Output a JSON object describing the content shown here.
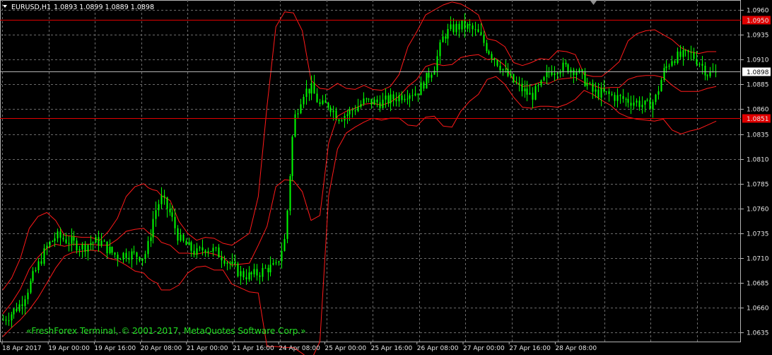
{
  "header": {
    "symbol_label": "EURUSD,H1",
    "ohlc_label": "1.0893 1.0899 1.0889 1.0898"
  },
  "watermark": "«FreshForex Terminal, © 2001-2017, MetaQuotes Software Corp.»",
  "colors": {
    "background": "#000000",
    "grid": "#6b6b6b",
    "candle": "#00ff00",
    "bands": "#ff1a1a",
    "level_line": "#e00000",
    "current_line": "#b4b4b4",
    "axis_text": "#e6e6e6",
    "watermark": "#22e022"
  },
  "chart_data": {
    "type": "line",
    "title": "",
    "symbol": "EURUSD",
    "timeframe": "H1",
    "ylim": [
      1.0626,
      1.097
    ],
    "grid": true,
    "y_ticks": [
      "1.0960",
      "1.0935",
      "1.0910",
      "1.0885",
      "1.0860",
      "1.0835",
      "1.0810",
      "1.0785",
      "1.0760",
      "1.0735",
      "1.0710",
      "1.0685",
      "1.0660",
      "1.0635"
    ],
    "x_ticks": [
      "18 Apr 2017",
      "19 Apr 00:00",
      "19 Apr 16:00",
      "20 Apr 08:00",
      "21 Apr 00:00",
      "21 Apr 16:00",
      "24 Apr 08:00",
      "25 Apr 00:00",
      "25 Apr 16:00",
      "26 Apr 08:00",
      "27 Apr 00:00",
      "27 Apr 16:00",
      "28 Apr 08:00"
    ],
    "levels": [
      {
        "name": "upper-level",
        "value": 1.095,
        "label": "1.0950"
      },
      {
        "name": "lower-level",
        "value": 1.0851,
        "label": "1.0851"
      }
    ],
    "current_price": {
      "value": 1.0898,
      "label": "1.0898"
    },
    "series": [
      {
        "type": "line",
        "x": [
          0,
          10,
          20,
          30,
          40,
          50,
          60,
          70,
          80,
          90,
          100,
          110,
          120,
          130,
          140,
          150,
          160,
          165,
          170,
          175,
          180,
          190,
          200,
          210,
          220,
          230,
          240,
          250,
          260,
          270,
          280,
          290,
          300,
          310,
          320,
          330,
          340,
          350,
          360,
          370,
          380,
          390,
          400,
          410,
          420,
          430,
          440,
          450,
          460,
          470,
          480,
          490,
          500,
          510,
          520,
          530,
          540,
          550,
          560,
          570,
          580,
          590,
          600,
          610,
          620,
          630,
          640,
          650,
          660,
          670,
          680,
          690,
          700,
          710,
          720,
          730,
          740,
          750,
          760,
          770,
          780,
          790,
          800,
          810
        ],
        "y": [
          1.0648,
          1.0655,
          1.0664,
          1.0683,
          1.0703,
          1.0722,
          1.0732,
          1.0729,
          1.0725,
          1.0721,
          1.0726,
          1.0727,
          1.0718,
          1.0712,
          1.0715,
          1.0713,
          1.0712,
          1.0724,
          1.0748,
          1.0763,
          1.077,
          1.0754,
          1.0729,
          1.0721,
          1.0715,
          1.0721,
          1.0717,
          1.0711,
          1.0702,
          1.0694,
          1.0692,
          1.0695,
          1.07,
          1.0701,
          1.073,
          1.0848,
          1.0877,
          1.0881,
          1.0863,
          1.0865,
          1.0852,
          1.0855,
          1.0861,
          1.0868,
          1.0867,
          1.0867,
          1.087,
          1.0873,
          1.0877,
          1.0877,
          1.089,
          1.0904,
          1.0934,
          1.0941,
          1.0944,
          1.0942,
          1.0935,
          1.0921,
          1.0909,
          1.0897,
          1.0887,
          1.0879,
          1.0873,
          1.0883,
          1.0898,
          1.0902,
          1.0902,
          1.09,
          1.0889,
          1.0877,
          1.0876,
          1.0874,
          1.0871,
          1.0869,
          1.0867,
          1.0863,
          1.0869,
          1.0898,
          1.0912,
          1.0913,
          1.0916,
          1.0908,
          1.0896,
          1.0896
        ]
      },
      {
        "type": "line",
        "x": [
          0,
          10,
          20,
          30,
          40,
          50,
          60,
          70,
          80,
          90,
          100,
          110,
          120,
          130,
          140,
          150,
          160,
          165,
          170,
          175,
          180,
          190,
          200,
          210,
          220,
          230,
          240,
          250,
          260,
          270,
          280,
          290,
          300,
          310,
          320,
          330,
          340,
          350,
          360,
          370,
          380,
          390,
          400,
          410,
          420,
          430,
          440,
          450,
          460,
          470,
          480,
          490,
          500,
          510,
          520,
          530,
          540,
          550,
          560,
          570,
          580,
          590,
          600,
          610,
          620,
          630,
          640,
          650,
          660,
          670,
          680,
          690,
          700,
          710,
          720,
          730,
          740,
          750,
          760,
          770,
          780,
          790,
          800,
          810
        ],
        "y": [
          1.0678,
          1.069,
          1.071,
          1.074,
          1.0752,
          1.0756,
          1.0748,
          1.0733,
          1.0732,
          1.0731,
          1.0731,
          1.0728,
          1.0737,
          1.075,
          1.0772,
          1.0782,
          1.0785,
          1.0781,
          1.0779,
          1.0778,
          1.0773,
          1.0768,
          1.0747,
          1.0735,
          1.0728,
          1.0731,
          1.073,
          1.0725,
          1.0723,
          1.0729,
          1.0735,
          1.0772,
          1.0863,
          1.0943,
          1.0958,
          1.0957,
          1.0939,
          1.0889,
          1.0881,
          1.088,
          1.0886,
          1.0881,
          1.088,
          1.0884,
          1.088,
          1.0879,
          1.0883,
          1.0895,
          1.0923,
          1.0938,
          1.0955,
          1.096,
          1.0965,
          1.0968,
          1.0966,
          1.0961,
          1.0955,
          1.0931,
          1.0929,
          1.0923,
          1.0907,
          1.0904,
          1.0907,
          1.0911,
          1.091,
          1.0919,
          1.0918,
          1.0915,
          1.0895,
          1.0893,
          1.0893,
          1.09,
          1.0908,
          1.0929,
          1.0936,
          1.0939,
          1.094,
          1.0935,
          1.093,
          1.0922,
          1.0918,
          1.0916,
          1.0918,
          1.0918
        ]
      },
      {
        "type": "line",
        "x": [
          0,
          10,
          20,
          30,
          40,
          50,
          60,
          70,
          80,
          90,
          100,
          110,
          120,
          130,
          140,
          150,
          160,
          165,
          170,
          175,
          180,
          190,
          200,
          210,
          220,
          230,
          240,
          250,
          260,
          270,
          280,
          290,
          300,
          310,
          320,
          330,
          340,
          350,
          360,
          370,
          380,
          390,
          400,
          410,
          420,
          430,
          440,
          450,
          460,
          470,
          480,
          490,
          500,
          510,
          520,
          530,
          540,
          550,
          560,
          570,
          580,
          590,
          600,
          610,
          620,
          630,
          640,
          650,
          660,
          670,
          680,
          690,
          700,
          710,
          720,
          730,
          740,
          750,
          760,
          770,
          780,
          790,
          800,
          810
        ],
        "y": [
          1.0631,
          1.064,
          1.0648,
          1.0658,
          1.067,
          1.0685,
          1.07,
          1.0712,
          1.0716,
          1.0717,
          1.0718,
          1.0717,
          1.071,
          1.0708,
          1.0703,
          1.0697,
          1.0695,
          1.069,
          1.0687,
          1.0685,
          1.0678,
          1.0678,
          1.0683,
          1.0695,
          1.0701,
          1.0702,
          1.0698,
          1.0698,
          1.0684,
          1.068,
          1.0676,
          1.0675,
          1.0621,
          1.0621,
          1.062,
          1.062,
          1.0614,
          1.0607,
          1.0626,
          1.0773,
          1.082,
          1.0836,
          1.0842,
          1.0847,
          1.0851,
          1.0849,
          1.0851,
          1.0851,
          1.0844,
          1.0843,
          1.0852,
          1.0853,
          1.0843,
          1.0842,
          1.0858,
          1.0868,
          1.0875,
          1.089,
          1.0893,
          1.0885,
          1.0872,
          1.0862,
          1.0861,
          1.0863,
          1.0863,
          1.0862,
          1.0865,
          1.087,
          1.0879,
          1.0875,
          1.0869,
          1.0864,
          1.0856,
          1.0852,
          1.085,
          1.0849,
          1.0848,
          1.085,
          1.0839,
          1.0835,
          1.0838,
          1.084,
          1.0844,
          1.0848
        ]
      },
      {
        "type": "line",
        "x": [
          0,
          10,
          20,
          30,
          40,
          50,
          60,
          70,
          80,
          90,
          100,
          110,
          120,
          130,
          140,
          150,
          160,
          165,
          170,
          175,
          180,
          190,
          200,
          210,
          220,
          230,
          240,
          250,
          260,
          270,
          280,
          290,
          300,
          310,
          320,
          330,
          340,
          350,
          360,
          370,
          380,
          390,
          400,
          410,
          420,
          430,
          440,
          450,
          460,
          470,
          480,
          490,
          500,
          510,
          520,
          530,
          540,
          550,
          560,
          570,
          580,
          590,
          600,
          610,
          620,
          630,
          640,
          650,
          660,
          670,
          680,
          690,
          700,
          710,
          720,
          730,
          740,
          750,
          760,
          770,
          780,
          790,
          800,
          810
        ],
        "y": [
          1.0654,
          1.0665,
          1.0679,
          1.0699,
          1.0711,
          1.072,
          1.0724,
          1.0722,
          1.0724,
          1.0724,
          1.0724,
          1.0723,
          1.0723,
          1.0729,
          1.0737,
          1.0739,
          1.074,
          1.0736,
          1.0733,
          1.0731,
          1.0726,
          1.0723,
          1.0715,
          1.0715,
          1.0714,
          1.0716,
          1.0714,
          1.0711,
          1.0703,
          1.0704,
          1.0705,
          1.0723,
          1.0742,
          1.0782,
          1.0789,
          1.0788,
          1.0777,
          1.0748,
          1.0753,
          1.0826,
          1.0853,
          1.0858,
          1.0861,
          1.0865,
          1.0866,
          1.0864,
          1.0867,
          1.0873,
          1.0883,
          1.089,
          1.0903,
          1.0906,
          1.0904,
          1.0905,
          1.0912,
          1.0914,
          1.0915,
          1.091,
          1.0911,
          1.0904,
          1.0889,
          1.0883,
          1.0884,
          1.0887,
          1.0886,
          1.089,
          1.0891,
          1.0892,
          1.0887,
          1.0884,
          1.0881,
          1.0882,
          1.0882,
          1.089,
          1.0893,
          1.0894,
          1.0894,
          1.0892,
          1.0884,
          1.0878,
          1.0878,
          1.0878,
          1.0881,
          1.0883
        ]
      }
    ]
  }
}
